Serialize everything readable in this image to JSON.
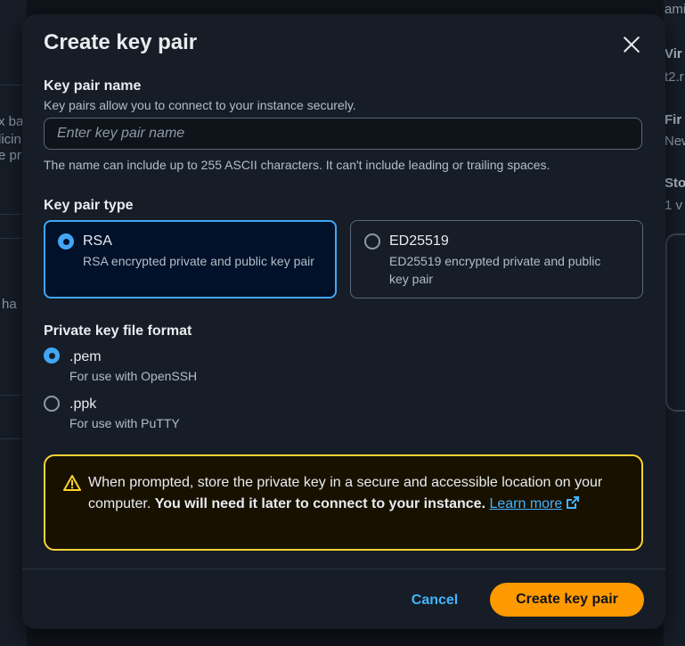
{
  "background": {
    "left_fragments": [
      "x ba",
      "licin",
      "e pr",
      "ha"
    ],
    "right_fragments": [
      "ami",
      "Vir",
      "t2.r",
      "Fir",
      "New",
      "Sto",
      "1 v"
    ]
  },
  "modal": {
    "title": "Create key pair",
    "close_icon": "close-icon",
    "key_pair_name": {
      "label": "Key pair name",
      "description": "Key pairs allow you to connect to your instance securely.",
      "value": "",
      "placeholder": "Enter key pair name",
      "constraint": "The name can include up to 255 ASCII characters. It can't include leading or trailing spaces."
    },
    "key_pair_type": {
      "label": "Key pair type",
      "options": [
        {
          "title": "RSA",
          "description": "RSA encrypted private and public key pair",
          "selected": true
        },
        {
          "title": "ED25519",
          "description": "ED25519 encrypted private and public key pair",
          "selected": false
        }
      ]
    },
    "private_key_format": {
      "label": "Private key file format",
      "options": [
        {
          "title": ".pem",
          "description": "For use with OpenSSH",
          "selected": true
        },
        {
          "title": ".ppk",
          "description": "For use with PuTTY",
          "selected": false
        }
      ]
    },
    "alert": {
      "icon": "warning-icon",
      "text_normal": "When prompted, store the private key in a secure and accessible location on your computer. ",
      "text_bold": "You will need it later to connect to your instance.",
      "link_text": "Learn more",
      "link_icon": "external-link-icon"
    },
    "footer": {
      "cancel_label": "Cancel",
      "create_label": "Create key pair"
    }
  },
  "colors": {
    "accent_blue": "#42a5f5",
    "link_blue": "#42b4ff",
    "primary_orange": "#ff9900",
    "warning_yellow": "#fbd332"
  }
}
